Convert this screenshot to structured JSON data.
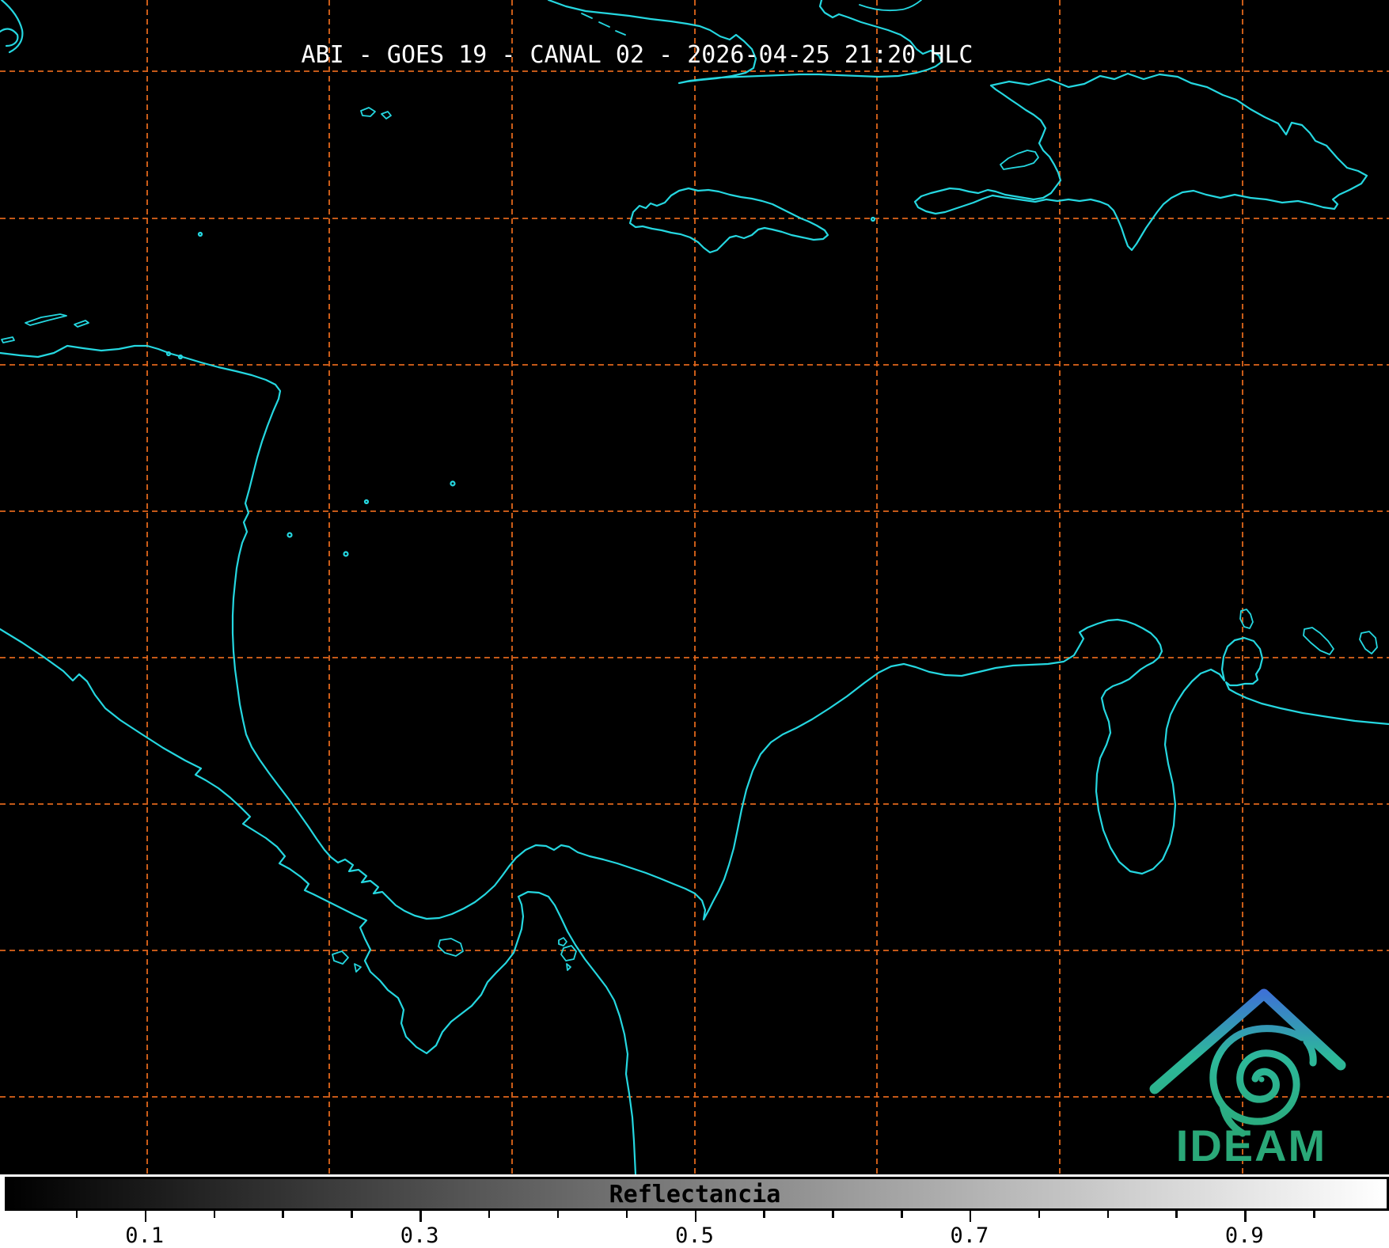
{
  "header": {
    "title": "ABI - GOES 19 - CANAL 02 - 2026-04-25 21:20 HLC"
  },
  "colorbar": {
    "label": "Reflectancia",
    "tick_labels": [
      "0.1",
      "0.3",
      "0.5",
      "0.7",
      "0.9"
    ],
    "tick_values": [
      0.1,
      0.3,
      0.5,
      0.7,
      0.9
    ],
    "minor_tick_step": 0.05,
    "value_range": [
      0.0,
      1.0
    ],
    "gradient_start": "#000000",
    "gradient_end": "#ffffff"
  },
  "logo": {
    "wordmark": "IDEAM",
    "green": "#2aa878",
    "blue": "#3e6fd8",
    "teal": "#2db89a"
  },
  "map": {
    "background": "#000000",
    "coastline_color": "#25d7e0",
    "gridline_color": "#e0661b",
    "title_color": "#ffffff",
    "colorbar_label_color": "#000000"
  }
}
